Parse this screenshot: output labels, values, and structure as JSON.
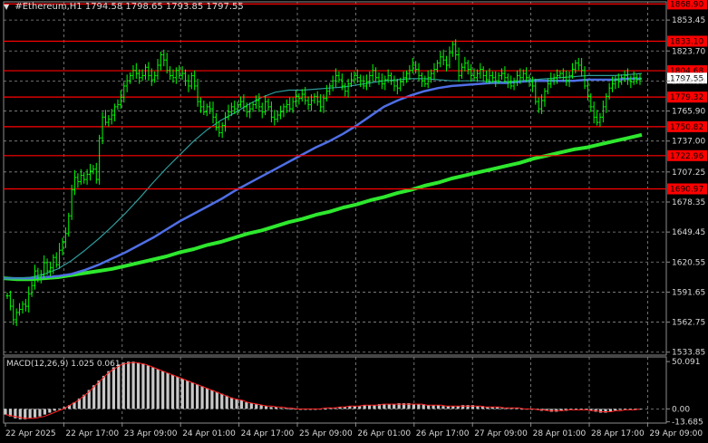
{
  "header": {
    "symbol": "#Ethereum,H1",
    "ohlc": "1794.58 1798.65 1793.85 1797.55"
  },
  "colors": {
    "background": "#000000",
    "grid": "#8c8c8c",
    "candle": "#00ff00",
    "hline": "#ff0000",
    "ma_fast": "#2e9a9a",
    "ma_mid": "#4f6fe6",
    "ma_slow": "#2ee82e",
    "macd_hist": "#c8c8c8",
    "macd_signal": "#ff2020",
    "axis_text": "#d8d8d8"
  },
  "chart_data": [
    {
      "type": "candlestick",
      "name": "price",
      "title": "#Ethereum,H1",
      "y_ticks": [
        "1853.45",
        "1823.70",
        "1794.80",
        "1765.90",
        "1737.00",
        "1707.25",
        "1678.35",
        "1649.45",
        "1620.55",
        "1591.65",
        "1562.75",
        "1533.85"
      ],
      "ylim": [
        1531,
        1871
      ],
      "current_price": "1797.55",
      "levels": [
        "1868.90",
        "1833.10",
        "1804.68",
        "1779.32",
        "1750.82",
        "1722.96",
        "1690.97"
      ],
      "x_ticks": [
        "22 Apr 2025",
        "22 Apr 17:00",
        "23 Apr 09:00",
        "24 Apr 01:00",
        "24 Apr 17:00",
        "25 Apr 09:00",
        "26 Apr 01:00",
        "26 Apr 17:00",
        "27 Apr 09:00",
        "28 Apr 01:00",
        "28 Apr 17:00",
        "29 Apr 09:00"
      ],
      "close": [
        1588,
        1578,
        1565,
        1572,
        1575,
        1580,
        1578,
        1590,
        1598,
        1612,
        1606,
        1608,
        1620,
        1612,
        1615,
        1625,
        1618,
        1632,
        1640,
        1648,
        1665,
        1690,
        1702,
        1698,
        1704,
        1700,
        1705,
        1708,
        1710,
        1700,
        1740,
        1760,
        1755,
        1758,
        1762,
        1770,
        1772,
        1779,
        1790,
        1795,
        1800,
        1805,
        1802,
        1798,
        1800,
        1808,
        1800,
        1796,
        1800,
        1810,
        1820,
        1815,
        1805,
        1800,
        1798,
        1805,
        1800,
        1802,
        1795,
        1790,
        1800,
        1790,
        1775,
        1770,
        1765,
        1770,
        1768,
        1760,
        1750,
        1745,
        1752,
        1760,
        1765,
        1770,
        1768,
        1772,
        1775,
        1770,
        1765,
        1768,
        1772,
        1776,
        1770,
        1765,
        1775,
        1770,
        1760,
        1758,
        1762,
        1765,
        1770,
        1772,
        1768,
        1775,
        1780,
        1778,
        1782,
        1776,
        1772,
        1776,
        1780,
        1775,
        1770,
        1778,
        1785,
        1790,
        1795,
        1800,
        1796,
        1790,
        1785,
        1792,
        1796,
        1800,
        1798,
        1795,
        1790,
        1794,
        1800,
        1805,
        1798,
        1795,
        1792,
        1796,
        1800,
        1795,
        1790,
        1788,
        1794,
        1798,
        1802,
        1805,
        1810,
        1806,
        1800,
        1795,
        1792,
        1798,
        1802,
        1806,
        1812,
        1818,
        1815,
        1810,
        1822,
        1830,
        1820,
        1800,
        1808,
        1812,
        1806,
        1800,
        1798,
        1802,
        1806,
        1800,
        1796,
        1800,
        1798,
        1795,
        1800,
        1802,
        1798,
        1794,
        1790,
        1795,
        1800,
        1798,
        1802,
        1798,
        1794,
        1790,
        1775,
        1768,
        1776,
        1785,
        1792,
        1796,
        1798,
        1800,
        1802,
        1798,
        1795,
        1800,
        1806,
        1812,
        1810,
        1805,
        1790,
        1780,
        1770,
        1760,
        1755,
        1760,
        1770,
        1780,
        1788,
        1792,
        1796,
        1794,
        1798,
        1800,
        1796,
        1794,
        1798,
        1796,
        1797
      ],
      "ma_fast": [
        1605,
        1605,
        1606,
        1609,
        1614,
        1622,
        1632,
        1643,
        1655,
        1668,
        1682,
        1697,
        1711,
        1724,
        1737,
        1748,
        1757,
        1764,
        1772,
        1779,
        1784,
        1786,
        1786,
        1787,
        1788,
        1789,
        1791,
        1793,
        1795,
        1796,
        1797,
        1797,
        1796,
        1795,
        1795,
        1795,
        1794,
        1794,
        1795,
        1796,
        1797,
        1798,
        1799,
        1800,
        1800,
        1800,
        1801,
        1802
      ],
      "ma_mid": [
        1605,
        1605,
        1605,
        1606,
        1607,
        1609,
        1613,
        1618,
        1624,
        1630,
        1637,
        1644,
        1652,
        1660,
        1667,
        1674,
        1681,
        1689,
        1696,
        1703,
        1710,
        1717,
        1724,
        1731,
        1737,
        1744,
        1752,
        1761,
        1770,
        1776,
        1781,
        1785,
        1788,
        1790,
        1791,
        1792,
        1793,
        1793,
        1794,
        1795,
        1795,
        1795,
        1795,
        1796,
        1796,
        1796,
        1797,
        1797
      ],
      "ma_slow": [
        1605,
        1604,
        1604,
        1605,
        1606,
        1608,
        1610,
        1612,
        1614,
        1617,
        1620,
        1623,
        1626,
        1630,
        1633,
        1637,
        1640,
        1644,
        1648,
        1651,
        1655,
        1659,
        1662,
        1666,
        1669,
        1673,
        1676,
        1680,
        1683,
        1687,
        1690,
        1694,
        1697,
        1701,
        1704,
        1707,
        1710,
        1713,
        1716,
        1720,
        1723,
        1726,
        1729,
        1731,
        1734,
        1737,
        1740,
        1743
      ]
    },
    {
      "type": "bar",
      "name": "macd",
      "title": "MACD(12,26,9) 1.025 0.061",
      "y_ticks": [
        "50.091",
        "0.00",
        "-13.685"
      ],
      "ylim": [
        -15,
        55
      ],
      "histogram": [
        -6,
        -8,
        -10,
        -11,
        -11,
        -10,
        -9,
        -8,
        -6,
        -4,
        -2,
        0,
        2,
        4,
        7,
        11,
        15,
        20,
        25,
        30,
        35,
        40,
        44,
        47,
        49,
        50,
        50,
        49,
        48,
        46,
        44,
        42,
        40,
        38,
        36,
        34,
        32,
        30,
        28,
        26,
        24,
        22,
        20,
        18,
        16,
        14,
        12,
        10,
        9,
        7,
        6,
        5,
        4,
        3,
        2,
        2,
        1,
        1,
        0,
        0,
        -1,
        -1,
        -1,
        -1,
        0,
        0,
        1,
        1,
        2,
        2,
        3,
        3,
        3,
        4,
        4,
        4,
        5,
        5,
        5,
        5,
        6,
        6,
        6,
        5,
        5,
        5,
        4,
        4,
        4,
        3,
        3,
        3,
        3,
        4,
        4,
        4,
        3,
        3,
        2,
        2,
        2,
        1,
        1,
        1,
        1,
        0,
        0,
        -1,
        -1,
        -2,
        -2,
        -3,
        -3,
        -2,
        -2,
        -1,
        -1,
        0,
        -1,
        -2,
        -3,
        -4,
        -4,
        -3,
        -2,
        -1,
        0,
        -1,
        -1,
        0
      ],
      "signal": [
        -6,
        -7,
        -8,
        -9,
        -10,
        -10,
        -10,
        -9,
        -8,
        -6,
        -4,
        -2,
        0,
        3,
        6,
        9,
        13,
        17,
        22,
        27,
        32,
        37,
        41,
        44,
        47,
        48,
        49,
        49,
        48,
        47,
        45,
        43,
        41,
        39,
        37,
        35,
        33,
        31,
        29,
        27,
        25,
        23,
        21,
        19,
        17,
        15,
        13,
        11,
        10,
        9,
        7,
        6,
        5,
        4,
        3,
        3,
        2,
        2,
        1,
        1,
        0,
        0,
        0,
        0,
        0,
        0,
        1,
        1,
        1,
        2,
        2,
        3,
        3,
        3,
        4,
        4,
        4,
        4,
        5,
        5,
        5,
        5,
        5,
        5,
        5,
        5,
        5,
        4,
        4,
        4,
        4,
        3,
        3,
        3,
        3,
        3,
        3,
        3,
        3,
        2,
        2,
        2,
        2,
        1,
        1,
        1,
        1,
        0,
        0,
        0,
        -1,
        -1,
        -2,
        -2,
        -2,
        -2,
        -1,
        -1,
        -1,
        -1,
        -1,
        -2,
        -2,
        -3,
        -3,
        -3,
        -2,
        -2,
        -1,
        -1,
        -1,
        0
      ]
    }
  ]
}
